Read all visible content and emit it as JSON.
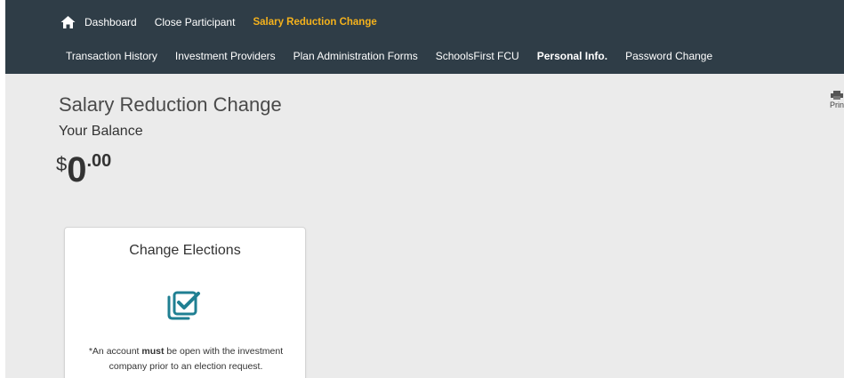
{
  "nav": {
    "row1": [
      {
        "label": "Dashboard",
        "active": false
      },
      {
        "label": "Close Participant",
        "active": false
      },
      {
        "label": "Salary Reduction Change",
        "active": true
      }
    ],
    "row2": [
      {
        "label": "Transaction History",
        "bold": false
      },
      {
        "label": "Investment Providers",
        "bold": false
      },
      {
        "label": "Plan Administration Forms",
        "bold": false
      },
      {
        "label": "SchoolsFirst FCU",
        "bold": false
      },
      {
        "label": "Personal Info.",
        "bold": true
      },
      {
        "label": "Password Change",
        "bold": false
      }
    ]
  },
  "print": {
    "label": "Prin"
  },
  "page": {
    "title": "Salary Reduction Change",
    "balance_label": "Your Balance",
    "balance": {
      "currency": "$",
      "whole": "0",
      "cents": ".00"
    }
  },
  "card": {
    "title": "Change Elections",
    "note_prefix": "*An account ",
    "note_bold": "must",
    "note_suffix": " be open with the investment company prior to an election request."
  },
  "colors": {
    "nav_bg": "#2f3d47",
    "active_link": "#f5b21c",
    "icon_teal": "#1f7f92",
    "page_bg": "#ebebeb"
  },
  "icons": {
    "home": "home-icon",
    "print": "printer-icon",
    "elections": "checkbox-stack-icon"
  }
}
